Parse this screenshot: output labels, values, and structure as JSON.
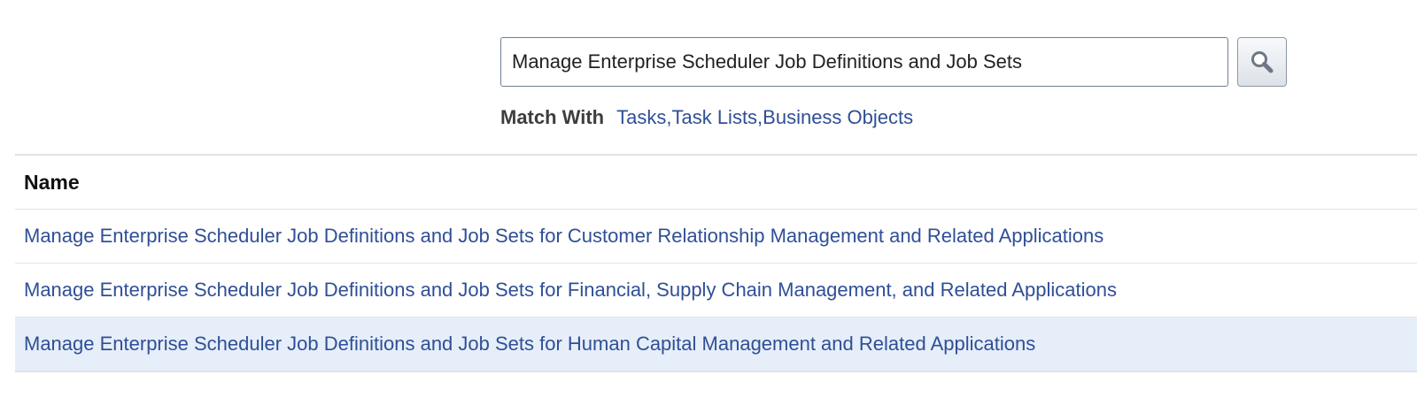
{
  "search": {
    "value": "Manage Enterprise Scheduler Job Definitions and Job Sets",
    "button_icon": "search-icon"
  },
  "match_with": {
    "label": "Match With",
    "value": "Tasks,Task Lists,Business Objects"
  },
  "results": {
    "columns": [
      "Name"
    ],
    "rows": [
      {
        "name": "Manage Enterprise Scheduler Job Definitions and Job Sets for Customer Relationship Management and Related Applications"
      },
      {
        "name": "Manage Enterprise Scheduler Job Definitions and Job Sets for Financial, Supply Chain Management, and Related Applications"
      },
      {
        "name": "Manage Enterprise Scheduler Job Definitions and Job Sets for Human Capital Management and Related Applications"
      }
    ]
  },
  "colors": {
    "link": "#2f4f96",
    "selected_row": "#e6eef9",
    "border": "#dfe2e6"
  }
}
